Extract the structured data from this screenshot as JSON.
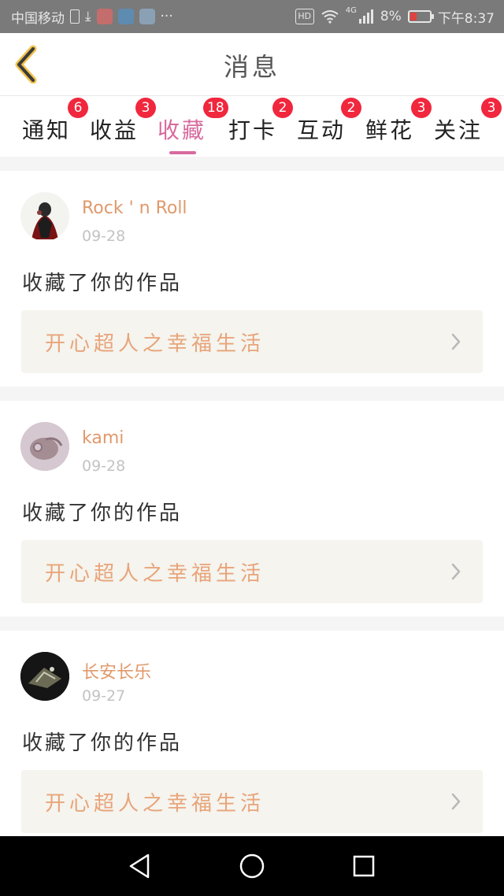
{
  "status_bar": {
    "carrier": "中国移动",
    "hd_label": "HD",
    "signal_label": "4G",
    "battery": "8%",
    "time": "下午8:37",
    "more": "···",
    "battery_level": 0.08
  },
  "header": {
    "title": "消息",
    "back_icon": "chevron-left-icon",
    "accent_color": "#d86a9e"
  },
  "tabs": [
    {
      "label": "通知",
      "badge": "6",
      "active": false
    },
    {
      "label": "收益",
      "badge": "3",
      "active": false
    },
    {
      "label": "收藏",
      "badge": "18",
      "active": true
    },
    {
      "label": "打卡",
      "badge": "2",
      "active": false
    },
    {
      "label": "互动",
      "badge": "2",
      "active": false
    },
    {
      "label": "鲜花",
      "badge": "3",
      "active": false
    },
    {
      "label": "关注",
      "badge": "3",
      "active": false
    }
  ],
  "messages": [
    {
      "username": "Rock ' n Roll",
      "date": "09-28",
      "action": "收藏了你的作品",
      "work_title": "开心超人之幸福生活"
    },
    {
      "username": "kami",
      "date": "09-28",
      "action": "收藏了你的作品",
      "work_title": "开心超人之幸福生活"
    },
    {
      "username": "长安长乐",
      "date": "09-27",
      "action": "收藏了你的作品",
      "work_title": "开心超人之幸福生活"
    }
  ],
  "nav": {
    "back_icon": "triangle-back-icon",
    "home_icon": "circle-home-icon",
    "recents_icon": "square-recents-icon"
  }
}
